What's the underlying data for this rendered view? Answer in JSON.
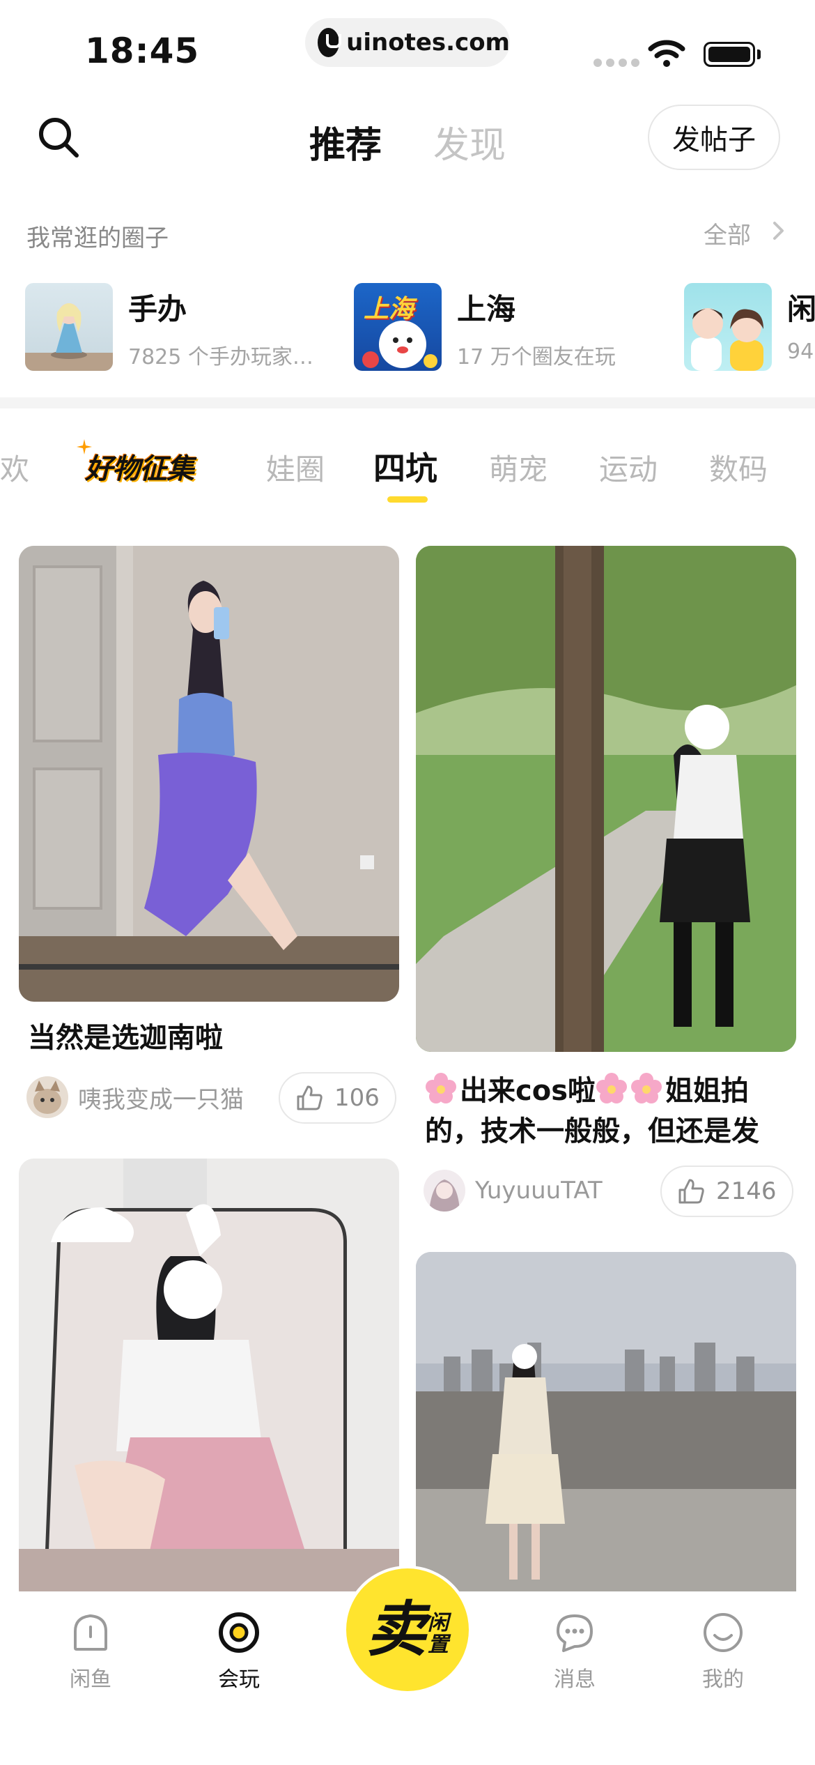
{
  "status_bar": {
    "time": "18:45",
    "url": "uinotes.com"
  },
  "header": {
    "tab_recommend": "推荐",
    "tab_discover": "发现",
    "post_button": "发帖子"
  },
  "circles": {
    "title": "我常逛的圈子",
    "all_label": "全部",
    "items": [
      {
        "name": "手办",
        "sub": "7825 个手办玩家…"
      },
      {
        "name": "上海",
        "sub": "17 万个圈友在玩"
      },
      {
        "name": "闲",
        "sub": "94"
      }
    ]
  },
  "categories": {
    "items": [
      "欢",
      "好物征集",
      "娃圈",
      "四坑",
      "萌宠",
      "运动",
      "数码"
    ],
    "active": "四坑"
  },
  "feed": [
    {
      "title": "当然是选迦南啦",
      "user": "咦我变成一只猫",
      "likes": "106"
    },
    {
      "title_line1": "出来cos啦",
      "title_line2": "姐姐拍",
      "title_line3": "的，技术一般般，但还是发",
      "user": "YuyuuuTAT",
      "likes": "2146"
    }
  ],
  "thumb_labels": {
    "shanghai": "上海"
  },
  "bottom_nav": {
    "items": [
      "闲鱼",
      "会玩",
      "消息",
      "我的"
    ],
    "active": "会玩",
    "sell_main": "卖",
    "sell_side_1": "闲",
    "sell_side_2": "置"
  },
  "colors": {
    "accent": "#ffe42e",
    "muted": "#9a9a9a"
  }
}
